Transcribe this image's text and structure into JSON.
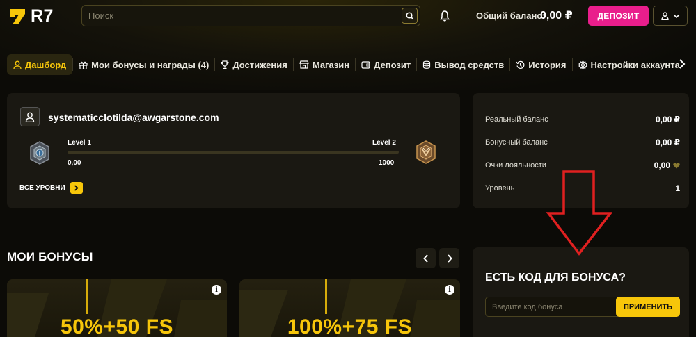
{
  "header": {
    "logo_text": "R7",
    "search_placeholder": "Поиск",
    "balance_label": "Общий баланс:",
    "balance_value": "0,00 ₽",
    "deposit_label": "ДЕПОЗИТ"
  },
  "tabs": [
    {
      "label": "Дашборд",
      "icon": "user-icon",
      "active": true
    },
    {
      "label": "Мои бонусы и награды (4)",
      "icon": "gift-icon"
    },
    {
      "label": "Достижения",
      "icon": "trophy-icon"
    },
    {
      "label": "Магазин",
      "icon": "shop-icon"
    },
    {
      "label": "Депозит",
      "icon": "wallet-icon"
    },
    {
      "label": "Вывод средств",
      "icon": "coins-icon"
    },
    {
      "label": "История",
      "icon": "history-icon"
    },
    {
      "label": "Настройки аккаунта",
      "icon": "gear-icon"
    }
  ],
  "profile": {
    "email": "systematicclotilda@awgarstone.com",
    "level_from_label": "Level 1",
    "level_to_label": "Level 2",
    "points_current": "0,00",
    "points_target": "1000",
    "progress": 0,
    "all_levels_label": "ВСЕ УРОВНИ"
  },
  "balances": [
    {
      "label": "Реальный баланс",
      "value": "0,00 ₽"
    },
    {
      "label": "Бонусный баланс",
      "value": "0,00 ₽"
    },
    {
      "label": "Очки лояльности",
      "value": "0,00",
      "icon": "heart-icon"
    },
    {
      "label": "Уровень",
      "value": "1"
    }
  ],
  "bonuses": {
    "title": "МОИ БОНУСЫ",
    "cards": [
      {
        "title": "50%+50 FS",
        "info": "i"
      },
      {
        "title": "100%+75 FS",
        "info": "i"
      }
    ]
  },
  "promo": {
    "title": "ЕСТЬ КОД ДЛЯ БОНУСА?",
    "placeholder": "Введите код бонуса",
    "apply_label": "ПРИМЕНИТЬ"
  },
  "colors": {
    "accent": "#f7c60a",
    "deposit": "#e91e8c",
    "background": "#0c0b07",
    "card": "#1a1812",
    "annotation_arrow": "#e02020"
  }
}
